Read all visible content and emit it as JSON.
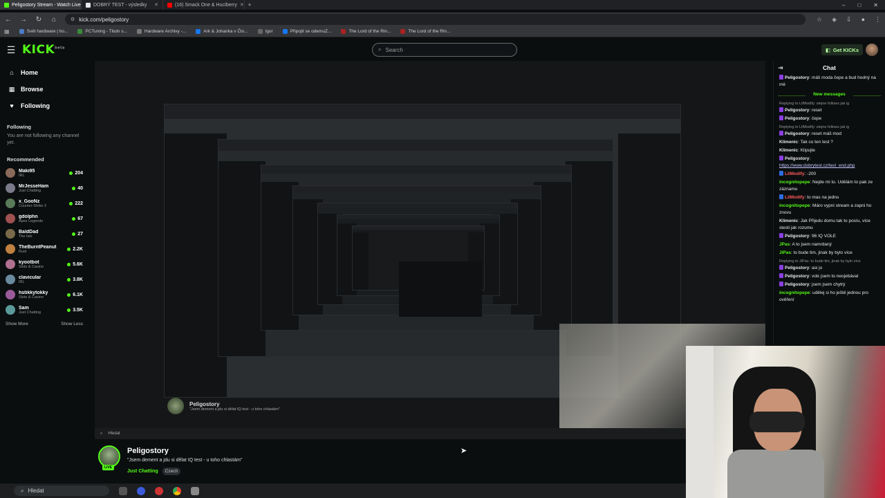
{
  "browser": {
    "tabs": [
      {
        "label": "Peligostory Stream - Watch Live",
        "color": "#53fc18",
        "active": true
      },
      {
        "label": "DOBRÝ TEST - výsledky",
        "color": "#e8e8e8",
        "active": false
      },
      {
        "label": "(16) Smack One & Hucíberry",
        "color": "#ff0000",
        "active": false
      }
    ],
    "new_tab": "+",
    "url": "kick.com/peligostory",
    "bookmarks": [
      {
        "label": "Svět hardware | ho...",
        "color": "#4a7cc4"
      },
      {
        "label": "PCTuning - Tituln s...",
        "color": "#3a8c3a"
      },
      {
        "label": "Hardware Archivy -...",
        "color": "#777777"
      },
      {
        "label": "Ark & Johanka v Člo...",
        "color": "#1877f2"
      },
      {
        "label": "Igor",
        "color": "#666666"
      },
      {
        "label": "Připojit se odemuZ...",
        "color": "#1877f2"
      },
      {
        "label": "The Lord of the Rin...",
        "color": "#aa2222"
      },
      {
        "label": "The Lord of the Rin...",
        "color": "#aa2222"
      }
    ]
  },
  "kick": {
    "logo": "KICK",
    "logo_sup": "beta",
    "search_placeholder": "Search",
    "get_kicks": "Get KICKs"
  },
  "sidebar": {
    "nav": [
      {
        "label": "Home",
        "icon": "⌂"
      },
      {
        "label": "Browse",
        "icon": "▦"
      },
      {
        "label": "Following",
        "icon": "♥"
      }
    ],
    "following_title": "Following",
    "following_empty": "You are not following any channel yet.",
    "recommended_title": "Recommended",
    "recommended": [
      {
        "name": "Maki95",
        "category": "IRL",
        "viewers": "204",
        "color": "#8a6a5a"
      },
      {
        "name": "MrJesseHam",
        "category": "Just Chatting",
        "viewers": "40",
        "color": "#7a7a8a"
      },
      {
        "name": "x_GooNz",
        "category": "Counter-Strike 2",
        "viewers": "222",
        "color": "#5a7a5a"
      },
      {
        "name": "gdolphn",
        "category": "Apex Legends",
        "viewers": "67",
        "color": "#a05050"
      },
      {
        "name": "BaldDad",
        "category": "The Isle",
        "viewers": "27",
        "color": "#7a6a4a"
      },
      {
        "name": "TheBurntPeanut",
        "category": "Rust",
        "viewers": "2.2K",
        "color": "#c08040"
      },
      {
        "name": "kyootbot",
        "category": "Slots & Casino",
        "viewers": "5.6K",
        "color": "#b07090"
      },
      {
        "name": "clavicular",
        "category": "IRL",
        "viewers": "3.8K",
        "color": "#6a8aa0"
      },
      {
        "name": "hstikkytokky",
        "category": "Slots & Casino",
        "viewers": "6.1K",
        "color": "#9a5a9a"
      },
      {
        "name": "Sam",
        "category": "Just Chatting",
        "viewers": "3.5K",
        "color": "#5a9a9a"
      }
    ],
    "show_more": "Show More",
    "show_less": "Show Less"
  },
  "inner": {
    "streamer": "Peligostory",
    "title": "\"Jsem dement a jdu si dělat IQ test - u toho chlastám\"",
    "search": "Hledat"
  },
  "stream": {
    "name": "Peligostory",
    "title": "\"Jsem dement a jdu si dělat IQ test - u toho chlastám\"",
    "category": "Just Chatting",
    "tag": "Czech",
    "live": "LIVE"
  },
  "chat": {
    "title": "Chat",
    "new_messages": "New messages",
    "messages": [
      {
        "user": "Peligostory",
        "text": "máš moda čepe a bud hodný na mě",
        "color": "#e8e8e8",
        "badge": true
      },
      {
        "divider": true
      },
      {
        "reply": "Replying to LilModify: stejne follows jak ig",
        "user": "Peligostory",
        "text": "reset",
        "color": "#e8e8e8",
        "badge": true
      },
      {
        "user": "Peligostory",
        "text": "čepe",
        "color": "#e8e8e8",
        "badge": true
      },
      {
        "reply": "Replying to LilModify: stejne follows jak ig",
        "user": "Peligostory",
        "text": "reset máš mod",
        "color": "#e8e8e8",
        "badge": true
      },
      {
        "user": "Klimenic",
        "text": "Tak co ten test ?",
        "color": "#e8e8e8"
      },
      {
        "user": "Klimenic",
        "text": "Klipujte",
        "color": "#e8e8e8"
      },
      {
        "user": "Peligostory",
        "text": "",
        "link": "https://www.dobrytest.cz/test_end.php",
        "color": "#e8e8e8",
        "badge": true
      },
      {
        "user": "LilModify",
        "text": "-200",
        "color": "#ff5a5a",
        "badge2": true
      },
      {
        "user": "incognitopepe",
        "text": "Nejde mi to. Udělám to pak ze záznamu",
        "color": "#53fc18"
      },
      {
        "user": "LilModify",
        "text": "to mas na jednu",
        "color": "#ff5a5a",
        "badge2": true
      },
      {
        "user": "incognitopepe",
        "text": "Máro vypni stream a zapni ho znovu",
        "color": "#53fc18"
      },
      {
        "user": "Klimenic",
        "text": "Jak Přijedu domu tak to posíu, více stesti jak rozumu",
        "color": "#e8e8e8"
      },
      {
        "user": "Peligostory",
        "text": "96 IQ VOLE",
        "color": "#e8e8e8",
        "badge": true
      },
      {
        "user": "JPas",
        "text": "A to jsem namrdaný",
        "color": "#53fc18"
      },
      {
        "user": "JiPas",
        "text": "to bude tim, jinak by bylo více",
        "color": "#53fc18"
      },
      {
        "reply": "Replying to JiPas: to bude tim, jinak by bylo více",
        "user": "Peligostory",
        "text": "asi jo",
        "color": "#e8e8e8",
        "badge": true
      },
      {
        "user": "Peligostory",
        "text": "volε jsem to neojebával",
        "color": "#e8e8e8",
        "badge": true
      },
      {
        "user": "Peligostory",
        "text": "jsem jsem chytrý",
        "color": "#e8e8e8",
        "badge": true
      },
      {
        "user": "incognitopepe",
        "text": "udělej si ho ještě jednou pro ověření",
        "color": "#53fc18"
      }
    ]
  },
  "taskbar": {
    "search": "Hledat"
  }
}
